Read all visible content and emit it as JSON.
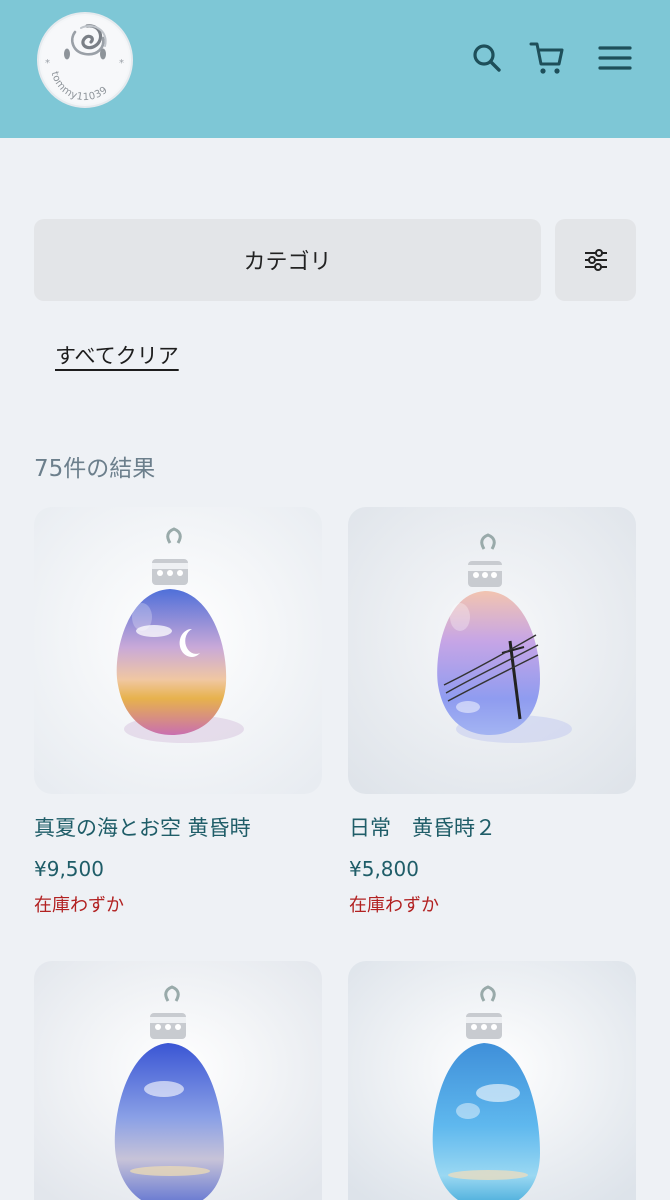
{
  "header": {
    "logo_text": "tommy11039",
    "icons": [
      "search-icon",
      "cart-icon",
      "menu-icon"
    ],
    "background": "#7ec7d6"
  },
  "filters": {
    "category_label": "カテゴリ",
    "filter_icon": "sliders-icon",
    "clear_all": "すべてクリア"
  },
  "results": {
    "count_text": "75件の結果"
  },
  "products": [
    {
      "title": "真夏の海とお空 黄昏時",
      "price": "¥9,500",
      "stock": "在庫わずか"
    },
    {
      "title": "日常　黄昏時２",
      "price": "¥5,800",
      "stock": "在庫わずか"
    },
    {
      "title": "",
      "price": "",
      "stock": ""
    },
    {
      "title": "",
      "price": "",
      "stock": ""
    }
  ],
  "colors": {
    "accent": "#1f5d68",
    "stock_warning": "#b22222",
    "page_bg": "#eef1f5"
  }
}
